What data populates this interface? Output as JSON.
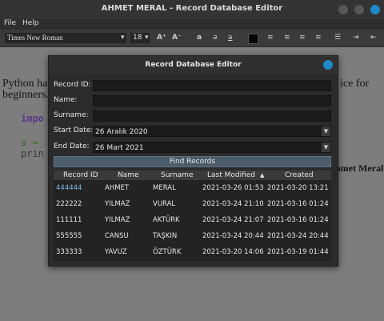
{
  "window": {
    "title": "AHMET MERAL - Record Database Editor"
  },
  "menu": {
    "file": "File",
    "help": "Help"
  },
  "toolbar": {
    "font": "Times New Roman",
    "size": "18"
  },
  "editor": {
    "line1_left": "Python has",
    "line1_right": "ice for",
    "line2_left": "beginners.",
    "code1": "impo",
    "code2": "a =",
    "code3": "prin",
    "right_text": "hmet Meral"
  },
  "dialog": {
    "title": "Record Database Editor",
    "fields": {
      "record_id_label": "Record ID:",
      "name_label": "Name:",
      "surname_label": "Surname:",
      "start_date_label": "Start Date:",
      "start_date_value": "26 Aralık 2020",
      "end_date_label": "End Date:",
      "end_date_value": "26 Mart 2021"
    },
    "find_button": "Find Records",
    "table": {
      "columns": [
        "Record ID",
        "Name",
        "Surname",
        "Last Modified",
        "Created"
      ],
      "rows": [
        [
          "444444",
          "AHMET",
          "MERAL",
          "2021-03-26 01:53",
          "2021-03-20 13:21"
        ],
        [
          "222222",
          "YILMAZ",
          "VURAL",
          "2021-03-24 21:10",
          "2021-03-16 01:24"
        ],
        [
          "111111",
          "YILMAZ",
          "AKTÜRK",
          "2021-03-24 21:07",
          "2021-03-16 01:24"
        ],
        [
          "555555",
          "CANSU",
          "TAŞKIN",
          "2021-03-24 20:44",
          "2021-03-24 20:44"
        ],
        [
          "333333",
          "YAVUZ",
          "ÖZTÜRK",
          "2021-03-20 14:06",
          "2021-03-19 01:44"
        ]
      ]
    }
  }
}
